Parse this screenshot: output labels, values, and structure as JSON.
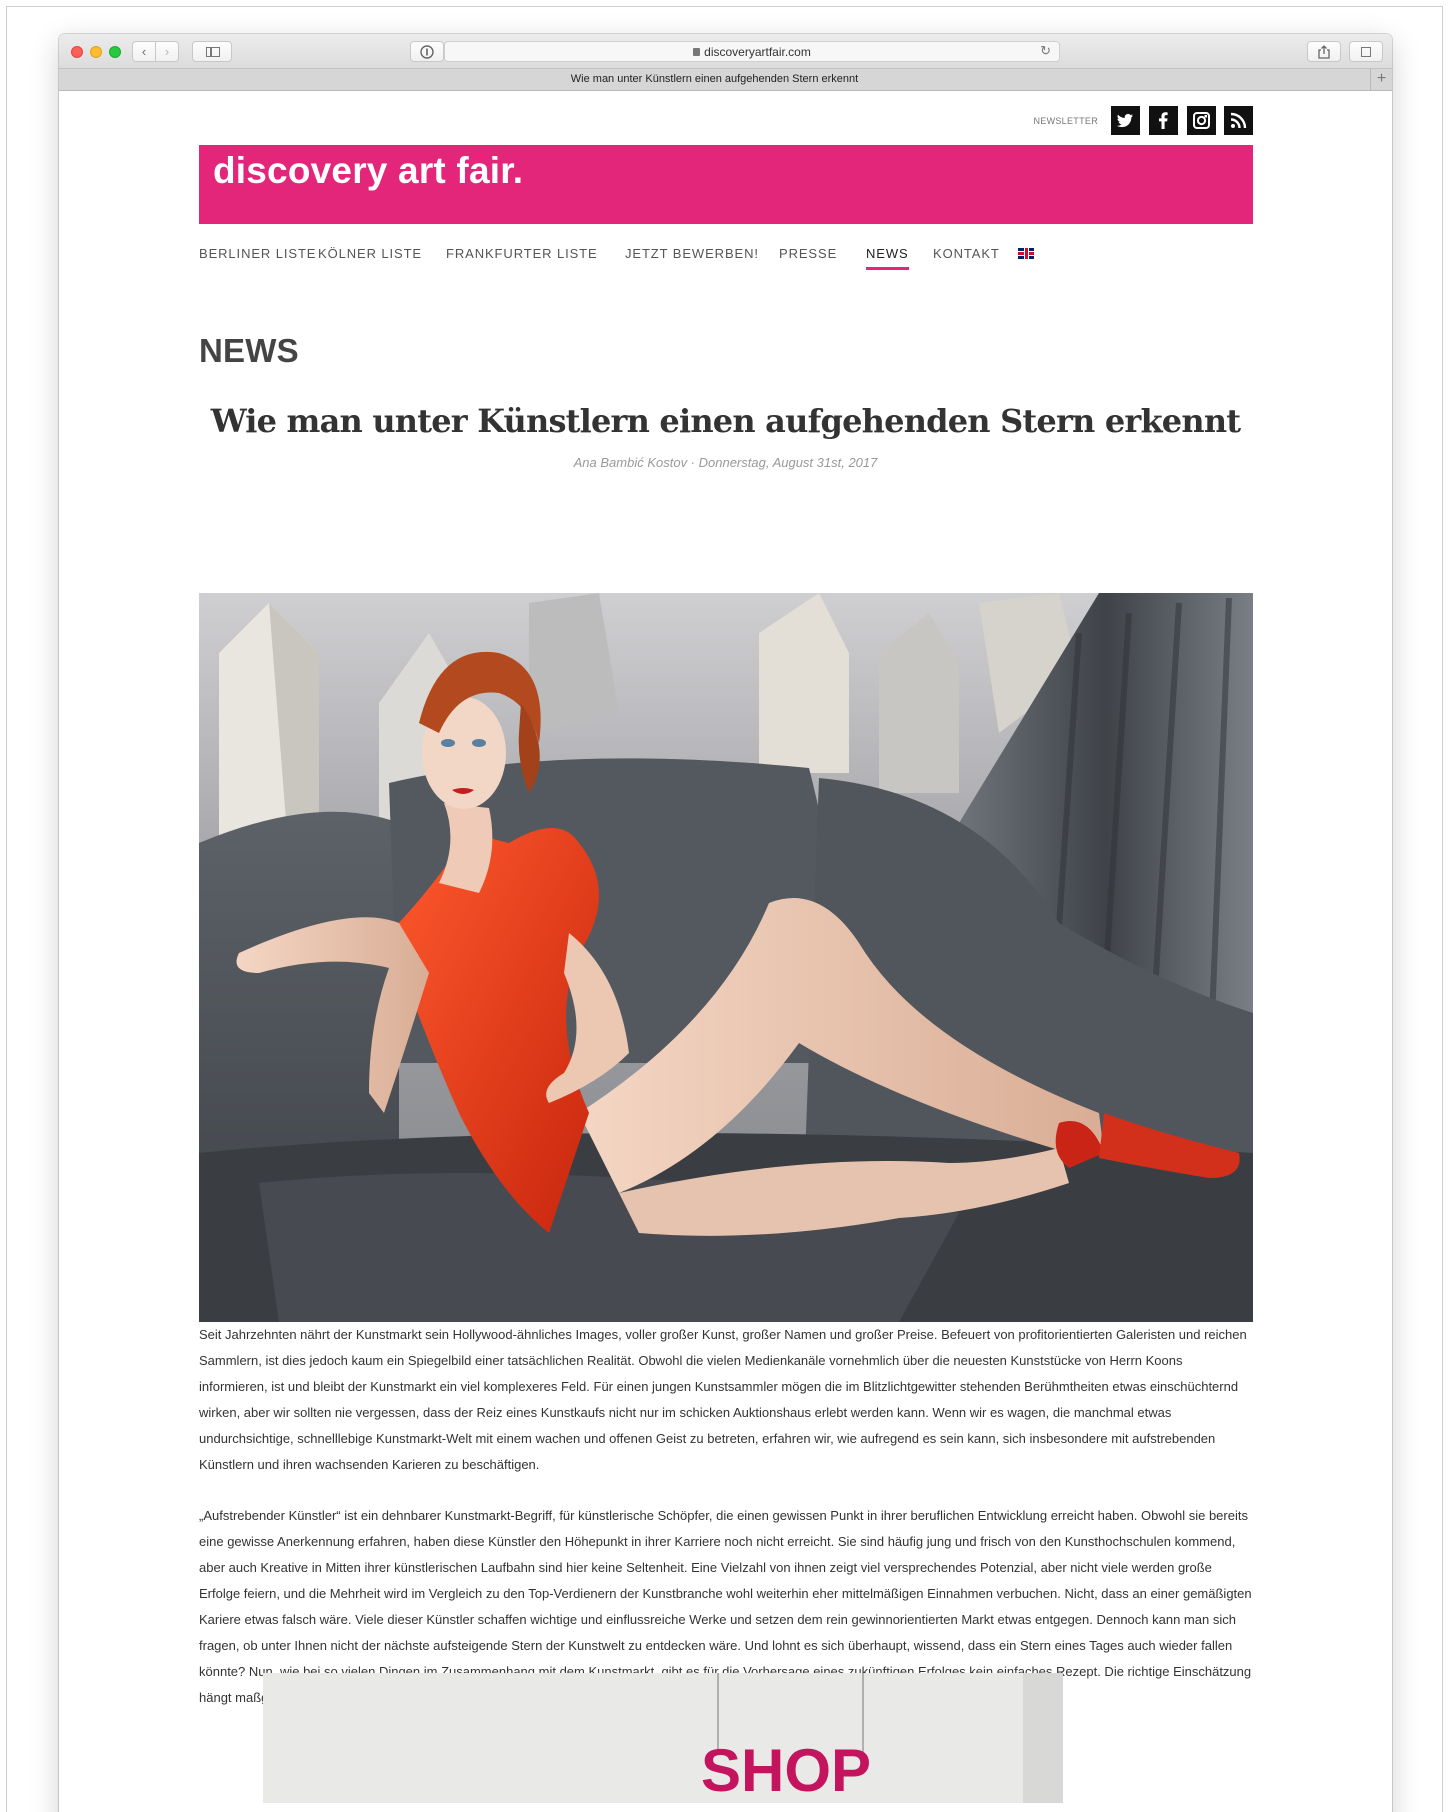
{
  "browser": {
    "url": "discoveryartfair.com",
    "tab_title": "Wie man unter Künstlern einen aufgehenden Stern erkennt",
    "icons": {
      "back": "chevron-left-icon",
      "forward": "chevron-right-icon",
      "sidebar": "sidebar-icon",
      "privacy": "privacy-icon",
      "reader": "reader-icon",
      "lock": "lock-icon",
      "reload": "reload-icon",
      "share": "share-icon",
      "tabs": "tabs-icon",
      "new_tab": "plus-icon"
    }
  },
  "header": {
    "newsletter_label": "NEWSLETTER",
    "social": [
      "twitter",
      "facebook",
      "instagram",
      "rss"
    ],
    "brand": "discovery art fair.",
    "brand_color": "#e3267a"
  },
  "nav": {
    "items": [
      {
        "label": "BERLINER LISTE"
      },
      {
        "label": "KÖLNER LISTE"
      },
      {
        "label": "FRANKFURTER LISTE"
      },
      {
        "label": "JETZT BEWERBEN!"
      },
      {
        "label": "PRESSE"
      },
      {
        "label": "NEWS",
        "active": true
      },
      {
        "label": "KONTAKT"
      }
    ],
    "language_icon": "uk-flag-icon"
  },
  "section_title": "NEWS",
  "article": {
    "title": "Wie man unter Künstlern einen aufgehenden Stern erkennt",
    "byline": "Ana Bambić Kostov · Donnerstag, August 31st, 2017",
    "paragraphs": [
      "Seit Jahrzehnten nährt der Kunstmarkt sein Hollywood-ähnliches Images, voller großer Kunst, großer Namen und großer Preise. Befeuert von profitorientierten Galeristen und reichen Sammlern, ist dies jedoch kaum ein Spiegelbild einer tatsächlichen Realität. Obwohl die vielen Medienkanäle vornehmlich über die neuesten Kunststücke von Herrn Koons informieren, ist und bleibt der Kunstmarkt ein viel komplexeres Feld. Für einen jungen Kunstsammler mögen die im Blitzlichtgewitter stehenden Berühmtheiten etwas einschüchternd wirken, aber wir sollten nie vergessen, dass der Reiz eines Kunstkaufs nicht nur im schicken Auktionshaus erlebt werden kann. Wenn wir es wagen, die manchmal etwas undurchsichtige, schnelllebige Kunstmarkt-Welt mit einem wachen und offenen Geist zu betreten, erfahren wir, wie aufregend es sein kann, sich insbesondere mit aufstrebenden Künstlern und ihren wachsenden Karieren zu beschäftigen.",
      "„Aufstrebender Künstler“ ist ein dehnbarer Kunstmarkt-Begriff, für künstlerische Schöpfer, die einen gewissen Punkt in ihrer beruflichen Entwicklung erreicht haben. Obwohl sie bereits eine gewisse Anerkennung erfahren, haben diese Künstler den Höhepunkt in ihrer Karriere noch nicht erreicht. Sie sind häufig jung und frisch von den Kunsthochschulen kommend, aber auch Kreative in Mitten ihrer künstlerischen Laufbahn sind hier keine Seltenheit. Eine Vielzahl von ihnen zeigt viel versprechendes Potenzial, aber nicht viele werden große Erfolge feiern, und die Mehrheit wird im Vergleich zu den Top-Verdienern der Kunstbranche wohl weiterhin eher mittelmäßigen Einnahmen verbuchen. Nicht, dass an einer gemäßigten Kariere etwas falsch wäre. Viele dieser Künstler schaffen wichtige und einflussreiche Werke und setzen dem rein gewinnorientierten Markt etwas entgegen. Dennoch kann man sich fragen, ob unter Ihnen nicht der nächste aufsteigende Stern der Kunstwelt zu entdecken wäre. Und lohnt es sich überhaupt, wissend, dass ein Stern eines Tages auch wieder fallen könnte? Nun, wie bei so vielen Dingen im Zusammenhang mit dem Kunstmarkt, gibt es für die Vorhersage eines zukünftigen Erfolges kein einfaches Rezept. Die richtige Einschätzung hängt maßgeblich von der Erfahrung und dem Wissen des Kunstsammlers ab, ergänzt von ein bisschen Glück."
    ],
    "second_image_text": "SHOP"
  }
}
